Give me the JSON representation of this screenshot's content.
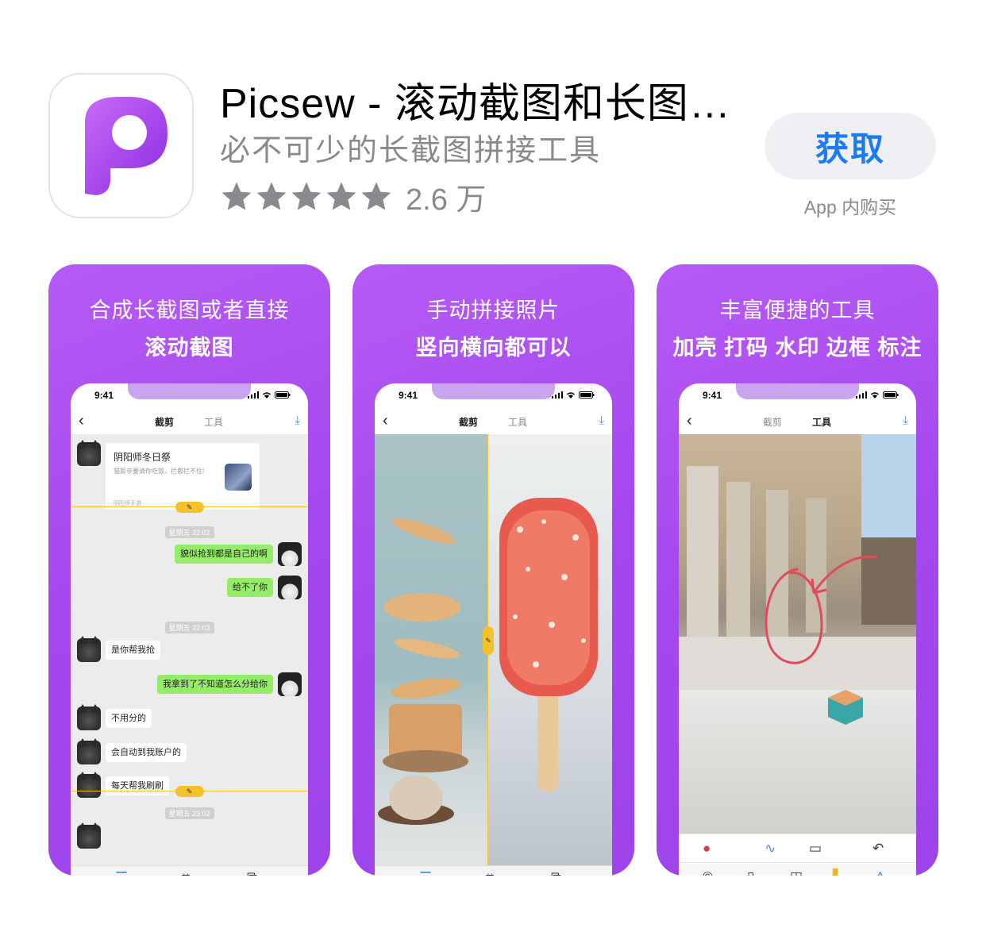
{
  "app": {
    "title": "Picsew - 滚动截图和长图…",
    "subtitle": "必不可少的长截图拼接工具",
    "rating": 5,
    "rating_count": "2.6 万",
    "get_label": "获取",
    "iap_label": "App 内购买",
    "icon_letter": "P",
    "accent_color": "#1a7cf5",
    "brand_color": "#a447ef"
  },
  "screenshots": [
    {
      "line1": "合成长截图或者直接",
      "line2": "滚动截图",
      "phone": {
        "time": "9:41",
        "tabs": [
          "截剪",
          "工具"
        ],
        "active_tab": 0,
        "card": {
          "title": "阴阳师冬日祭",
          "desc": "猫姬非要请你吃饭，拦都拦不住!",
          "source": "阴阳师手游"
        },
        "chat": [
          {
            "type": "time",
            "text": "星期五 22:02"
          },
          {
            "type": "out",
            "text": "貌似抢到都是自己的啊"
          },
          {
            "type": "out",
            "text": "给不了你"
          },
          {
            "type": "time",
            "text": "星期五 22:03"
          },
          {
            "type": "in",
            "text": "是你帮我抢"
          },
          {
            "type": "out",
            "text": "我拿到了不知道怎么分给你"
          },
          {
            "type": "in",
            "text": "不用分的"
          },
          {
            "type": "in",
            "text": "会自动到我账户的"
          },
          {
            "type": "in",
            "text": "每天帮我刷刷"
          },
          {
            "type": "time",
            "text": "星期五 23:02"
          }
        ]
      }
    },
    {
      "line1": "手动拼接照片",
      "line2": "竖向横向都可以",
      "phone": {
        "time": "9:41",
        "tabs": [
          "截剪",
          "工具"
        ],
        "active_tab": 0
      }
    },
    {
      "line1": "丰富便捷的工具",
      "line2": "加壳 打码 水印 边框 标注",
      "phone": {
        "time": "9:41",
        "tabs": [
          "截剪",
          "工具"
        ],
        "active_tab": 1
      }
    }
  ],
  "icons": {
    "back": "chevron-left-icon",
    "download": "download-icon",
    "tabbar": [
      "list-icon",
      "crop-icon",
      "crop-ratio-icon"
    ],
    "tools_top": [
      "red-dot-icon",
      "pen-icon",
      "rectangle-icon",
      "undo-icon"
    ],
    "tools_bottom": [
      "copyright-icon",
      "phone-frame-icon",
      "layout-icon",
      "highlight-icon",
      "text-style-icon"
    ]
  }
}
